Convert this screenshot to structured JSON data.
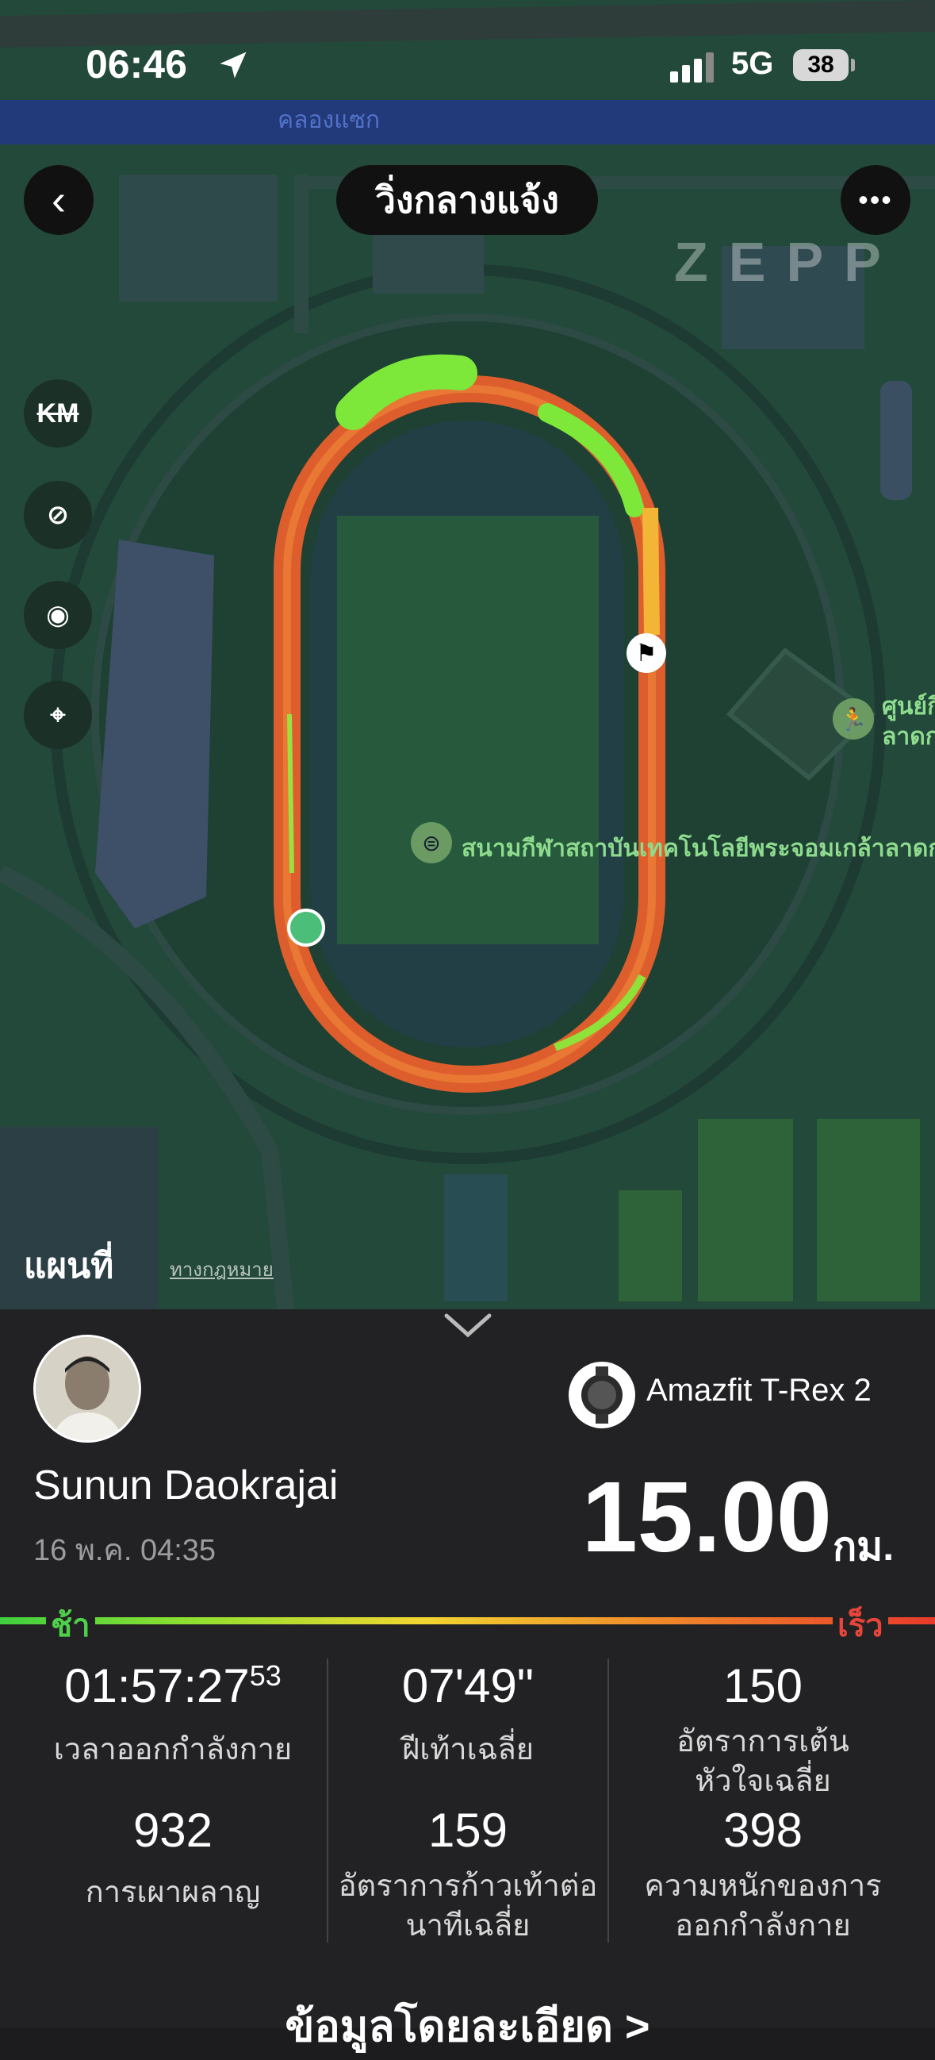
{
  "status_bar": {
    "time": "06:46",
    "network": "5G",
    "battery": "38"
  },
  "map": {
    "canal_label": "คลองแซก",
    "title": "วิ่งกลางแจ้ง",
    "brand": "ZEPP",
    "side_buttons": [
      "km-markers-toggle",
      "pace-toggle",
      "view-toggle",
      "locate"
    ],
    "km_label": "KM",
    "poi_stadium": "สนามกีฬาสถาบันเทคโนโลยีพระจอมเกล้าลาดก",
    "poi_center": "ศูนย์กี\nลาดก",
    "maps_brand": "แผนที่",
    "legal": "ทางกฎหมาย"
  },
  "activity": {
    "user_name": "Sunun Daokrajai",
    "date": "16 พ.ค. 04:35",
    "device": "Amazfit T-Rex 2",
    "distance": "15.00",
    "distance_unit": "กม.",
    "pace_slow": "ช้า",
    "pace_fast": "เร็ว",
    "stats": [
      {
        "value": "01:57:27",
        "sup": "53",
        "label": "เวลาออกกำลังกาย"
      },
      {
        "value": "07'49\"",
        "label": "ฝีเท้าเฉลี่ย"
      },
      {
        "value": "150",
        "label": "อัตราการเต้น\nหัวใจเฉลี่ย"
      },
      {
        "value": "932",
        "label": "การเผาผลาญ"
      },
      {
        "value": "159",
        "label": "อัตราการก้าวเท้าต่อ\nนาทีเฉลี่ย"
      },
      {
        "value": "398",
        "label": "ความหนักของการ\nออกกำลังกาย"
      }
    ],
    "detail_link": "ข้อมูลโดยละเอียด >"
  },
  "colors": {
    "track_fast": "#f26a2a",
    "track_slow": "#7de83a",
    "panel_bg": "#222224",
    "map_bg": "#23493a"
  }
}
